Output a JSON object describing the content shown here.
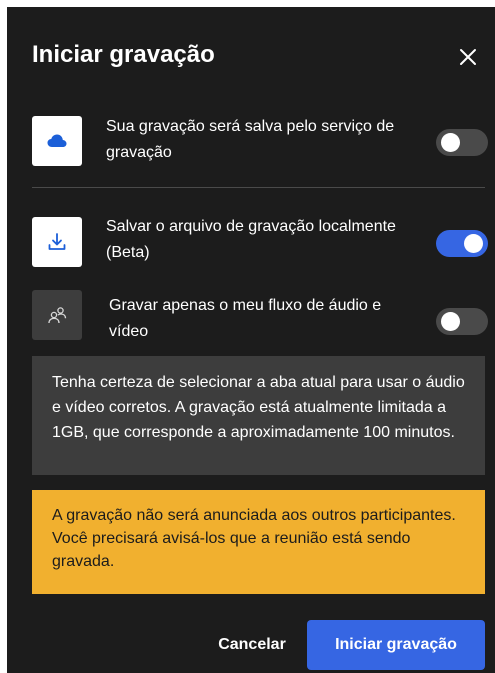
{
  "dialog": {
    "title": "Iniciar gravação",
    "close_icon": "close-icon"
  },
  "options": [
    {
      "icon": "cloud-icon",
      "label": "Sua gravação será salva pelo serviço de gravação",
      "enabled": false
    },
    {
      "icon": "download-icon",
      "label": "Salvar o arquivo de gravação localmente (Beta)",
      "enabled": true
    },
    {
      "icon": "participants-icon",
      "label": "Gravar apenas o meu fluxo de áudio e vídeo",
      "enabled": false
    }
  ],
  "info": {
    "text": "Tenha certeza de selecionar a aba atual para usar o áudio e vídeo corretos. A gravação está atualmente limitada a 1GB, que corresponde a aproximadamente 100 minutos."
  },
  "warning": {
    "text": "A gravação não será anunciada aos outros participantes. Você precisará avisá-los que a reunião está sendo gravada."
  },
  "buttons": {
    "cancel": "Cancelar",
    "start": "Iniciar gravação"
  },
  "colors": {
    "background": "#1c1c1c",
    "accent": "#3666e3",
    "warning": "#f1b02f",
    "info_box": "#3d3d3d"
  }
}
